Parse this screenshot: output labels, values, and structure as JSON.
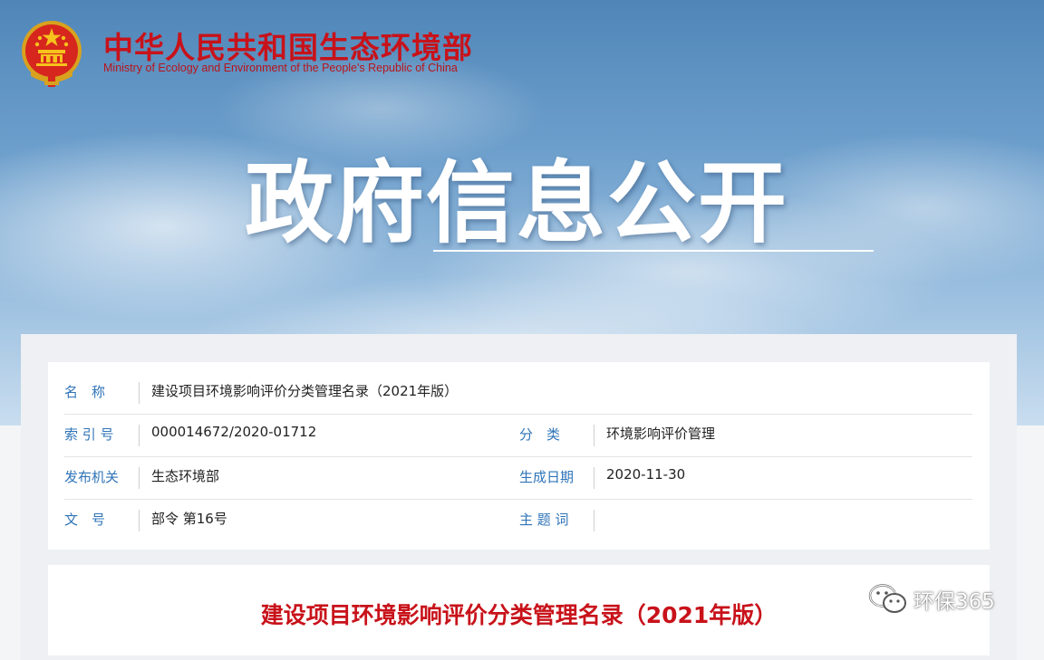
{
  "header": {
    "ministry_cn": "中华人民共和国生态环境部",
    "ministry_en": "Ministry of Ecology and Environment of the People's Republic of China",
    "banner_title": "政府信息公开"
  },
  "info": {
    "name_label": "名　称",
    "name_value": "建设项目环境影响评价分类管理名录（2021年版）",
    "index_label": "索 引 号",
    "index_value": "000014672/2020-01712",
    "category_label": "分　类",
    "category_value": "环境影响评价管理",
    "issuer_label": "发布机关",
    "issuer_value": "生态环境部",
    "date_label": "生成日期",
    "date_value": "2020-11-30",
    "doc_no_label": "文　号",
    "doc_no_value": "部令 第16号",
    "keywords_label": "主 题 词",
    "keywords_value": ""
  },
  "document": {
    "title": "建设项目环境影响评价分类管理名录（2021年版）"
  },
  "watermark": {
    "text": "环保365"
  },
  "colors": {
    "brand_red": "#c8121a",
    "label_blue": "#2f74b8"
  }
}
